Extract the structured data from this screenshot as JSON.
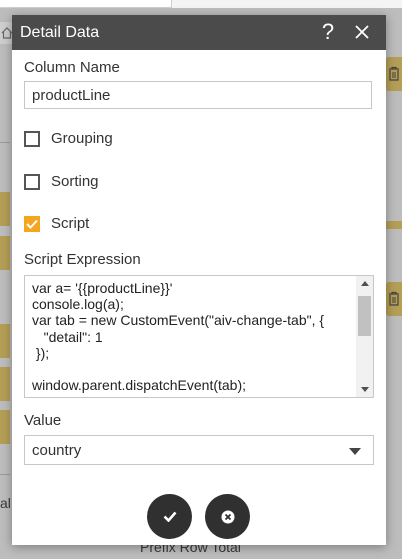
{
  "background": {
    "left_fragment_text": "al",
    "bottom_text": "Prefix Row Total"
  },
  "dialog": {
    "title": "Detail Data",
    "help_symbol": "?",
    "column_name_label": "Column Name",
    "column_name_value": "productLine",
    "checkboxes": [
      {
        "label": "Grouping",
        "checked": false
      },
      {
        "label": "Sorting",
        "checked": false
      },
      {
        "label": "Script",
        "checked": true
      }
    ],
    "script_expression_label": "Script Expression",
    "script_expression_value": "var a= '{{productLine}}'\nconsole.log(a);\nvar tab = new CustomEvent(\"aiv-change-tab\", {\n   \"detail\": 1\n });\n\nwindow.parent.dispatchEvent(tab);",
    "value_label": "Value",
    "value_selected": "country"
  },
  "colors": {
    "header_bg": "#4b4b4b",
    "checkbox_accent": "#f5a51f",
    "round_button_bg": "#303030",
    "background_tab_gold": "#b59f57",
    "overlay_gray": "#bdbdbd"
  },
  "icons": [
    "home-icon",
    "trash-icon",
    "help-icon",
    "close-icon",
    "checkmark-icon",
    "scroll-up-arrow-icon",
    "scroll-down-arrow-icon",
    "dropdown-caret-icon",
    "confirm-check-icon",
    "cancel-x-icon"
  ]
}
